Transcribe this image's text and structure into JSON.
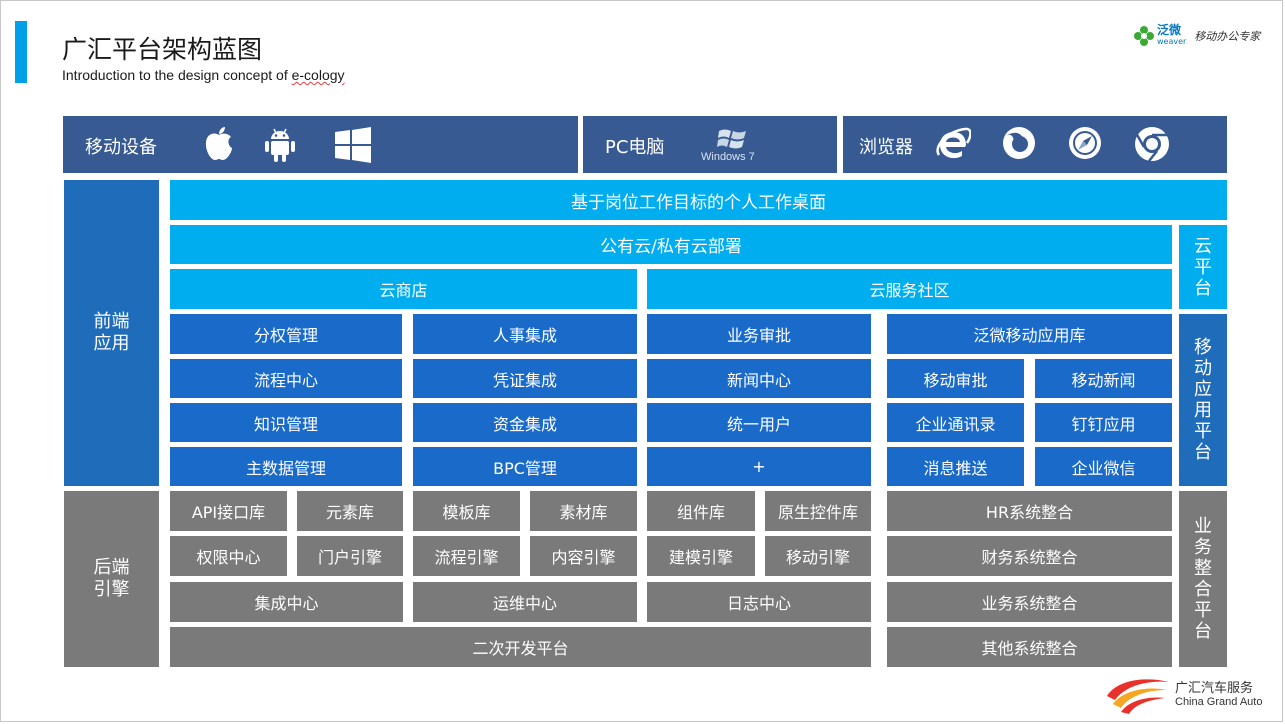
{
  "header": {
    "title": "广汇平台架构蓝图",
    "subtitle_prefix": "Introduction to the design concept of ",
    "subtitle_underlined": "e-cology"
  },
  "logos": {
    "weaver_cn": "泛微",
    "weaver_en": "weaver",
    "weaver_slogan": "移动办公专家",
    "company_cn": "广汇汽车服务",
    "company_en": "China Grand Auto"
  },
  "devices": {
    "mobile_label": "移动设备",
    "pc_label": "PC电脑",
    "pc_os": "Windows 7",
    "browser_label": "浏览器",
    "mobile_icons": [
      "apple-icon",
      "android-icon",
      "windows-icon"
    ],
    "browser_icons": [
      "ie-icon",
      "firefox-icon",
      "safari-icon",
      "chrome-icon"
    ]
  },
  "side_labels": {
    "front": "前端应用",
    "back": "后端引擎",
    "cloud_platform": [
      "云",
      "平",
      "台"
    ],
    "mobile_platform": [
      "移",
      "动",
      "应",
      "用",
      "平",
      "台"
    ],
    "business_platform": [
      "业",
      "务",
      "整",
      "合",
      "平",
      "台"
    ]
  },
  "front": {
    "desktop": "基于岗位工作目标的个人工作桌面",
    "cloud_deploy": "公有云/私有云部署",
    "cloud_store": "云商店",
    "cloud_community": "云服务社区",
    "col1": [
      "分权管理",
      "流程中心",
      "知识管理",
      "主数据管理"
    ],
    "col2": [
      "人事集成",
      "凭证集成",
      "资金集成",
      "BPC管理"
    ],
    "col3": [
      "业务审批",
      "新闻中心",
      "统一用户",
      "+"
    ],
    "mobile_lib": "泛微移动应用库",
    "mobile_apps": [
      "移动审批",
      "移动新闻",
      "企业通讯录",
      "钉钉应用",
      "消息推送",
      "企业微信"
    ]
  },
  "back": {
    "row1": [
      "API接口库",
      "元素库",
      "模板库",
      "素材库",
      "组件库",
      "原生控件库"
    ],
    "row2": [
      "权限中心",
      "门户引擎",
      "流程引擎",
      "内容引擎",
      "建模引擎",
      "移动引擎"
    ],
    "row3": [
      "集成中心",
      "运维中心",
      "日志中心"
    ],
    "dev_platform": "二次开发平台",
    "integrations": [
      "HR系统整合",
      "财务系统整合",
      "业务系统整合",
      "其他系统整合"
    ]
  }
}
